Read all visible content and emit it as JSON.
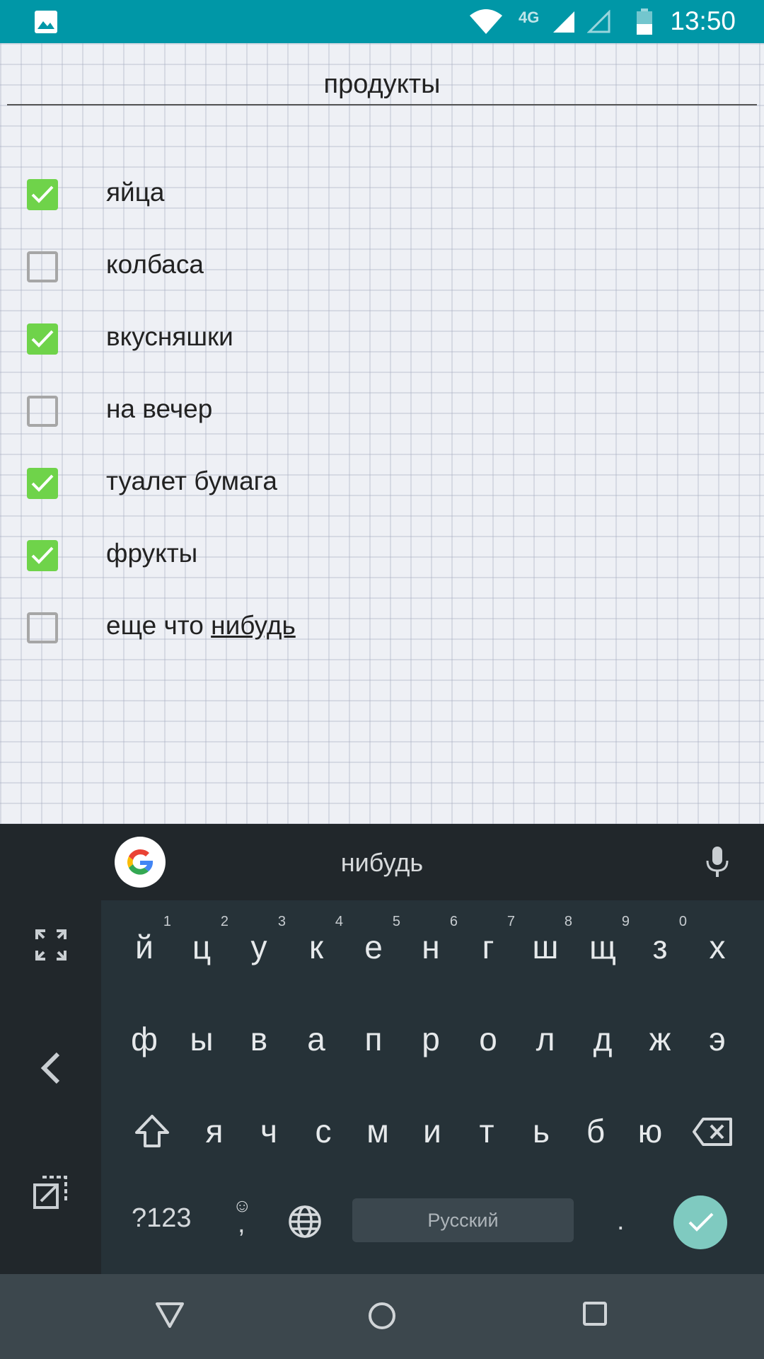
{
  "status_bar": {
    "network_type": "4G",
    "time": "13:50",
    "icons": [
      "gallery-icon",
      "wifi-icon",
      "signal-icon",
      "signal-empty-icon",
      "battery-icon"
    ],
    "background_color": "#0097a7"
  },
  "note": {
    "title": "продукты",
    "items": [
      {
        "label": "яйца",
        "checked": true
      },
      {
        "label": "колбаса",
        "checked": false
      },
      {
        "label": "вкусняшки",
        "checked": true
      },
      {
        "label": "на вечер",
        "checked": false
      },
      {
        "label": "туалет бумага",
        "checked": true
      },
      {
        "label": "фрукты",
        "checked": true
      },
      {
        "label_plain": "еще что ",
        "label_underlined": "нибудь",
        "checked": false
      }
    ],
    "check_color": "#6fd34a"
  },
  "keyboard": {
    "suggestion": "нибудь",
    "row1": [
      {
        "key": "й",
        "hint": "1"
      },
      {
        "key": "ц",
        "hint": "2"
      },
      {
        "key": "у",
        "hint": "3"
      },
      {
        "key": "к",
        "hint": "4"
      },
      {
        "key": "е",
        "hint": "5"
      },
      {
        "key": "н",
        "hint": "6"
      },
      {
        "key": "г",
        "hint": "7"
      },
      {
        "key": "ш",
        "hint": "8"
      },
      {
        "key": "щ",
        "hint": "9"
      },
      {
        "key": "з",
        "hint": "0"
      },
      {
        "key": "х",
        "hint": ""
      }
    ],
    "row2": [
      "ф",
      "ы",
      "в",
      "а",
      "п",
      "р",
      "о",
      "л",
      "д",
      "ж",
      "э"
    ],
    "row3": [
      "я",
      "ч",
      "с",
      "м",
      "и",
      "т",
      "ь",
      "б",
      "ю"
    ],
    "symbols_label": "?123",
    "emoji_label": "☺",
    "comma_label": ",",
    "space_label": "Русский",
    "period_label": ".",
    "enter_color": "#7fcac0"
  },
  "nav_bar": {
    "buttons": [
      "back-icon",
      "home-icon",
      "recents-icon"
    ]
  }
}
